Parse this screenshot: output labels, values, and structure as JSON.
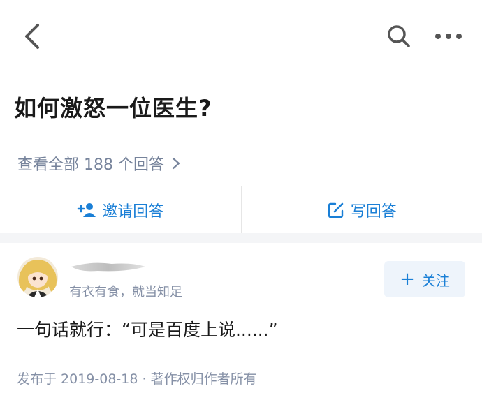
{
  "nav": {
    "back_icon": "chevron-left-icon",
    "search_icon": "search-icon",
    "more_icon": "more-horizontal-icon"
  },
  "question": {
    "title": "如何激怒一位医生?",
    "view_all": "查看全部 188 个回答"
  },
  "actions": {
    "invite_label": "邀请回答",
    "write_label": "写回答"
  },
  "answer": {
    "user_bio": "有衣有食，就当知足",
    "follow_label": "关注",
    "text": "一句话就行：“可是百度上说......”",
    "meta": "发布于 2019-08-18 · 著作权归作者所有"
  },
  "colors": {
    "accent": "#1a7fd6",
    "muted": "#8590a6",
    "link_gray": "#76839b",
    "band": "#f4f5f7"
  }
}
